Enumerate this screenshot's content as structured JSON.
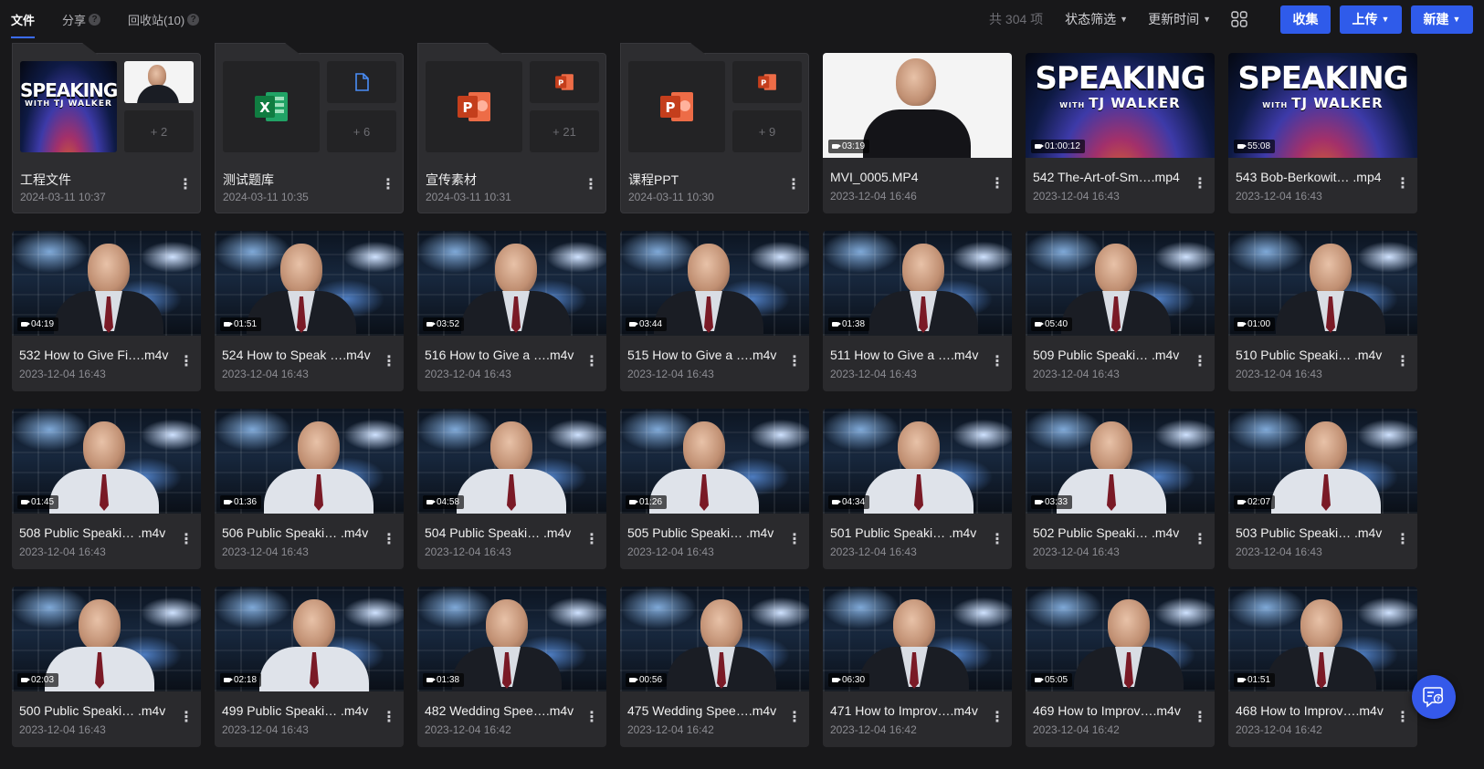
{
  "tabs": [
    {
      "label": "文件",
      "active": true
    },
    {
      "label": "分享",
      "help": "?"
    },
    {
      "label": "回收站(10)",
      "help": "?"
    }
  ],
  "toolbar": {
    "count": "共 304 项",
    "filter_label": "状态筛选",
    "sort_label": "更新时间",
    "collect_label": "收集",
    "upload_label": "上传",
    "new_label": "新建"
  },
  "folders": [
    {
      "name": "工程文件",
      "date": "2024-03-11 10:37",
      "more_count": "+ 2",
      "preview": "speaking"
    },
    {
      "name": "测试题库",
      "date": "2024-03-11 10:35",
      "more_count": "+ 6",
      "preview": "excel"
    },
    {
      "name": "宣传素材",
      "date": "2024-03-11 10:31",
      "more_count": "+ 21",
      "preview": "ppt"
    },
    {
      "name": "课程PPT",
      "date": "2024-03-11 10:30",
      "more_count": "+ 9",
      "preview": "ppt"
    }
  ],
  "videos": [
    {
      "name": "MVI_0005.MP4",
      "date": "2023-12-04 16:46",
      "duration": "03:19",
      "scene": "white"
    },
    {
      "name": "542 The-Art-of-Sm….mp4",
      "date": "2023-12-04 16:43",
      "duration": "01:00:12",
      "scene": "speaking"
    },
    {
      "name": "543 Bob-Berkowit… .mp4",
      "date": "2023-12-04 16:43",
      "duration": "55:08",
      "scene": "speaking"
    },
    {
      "name": "532 How to Give Fi….m4v",
      "date": "2023-12-04 16:43",
      "duration": "04:19",
      "scene": "studio"
    },
    {
      "name": "524 How to Speak ….m4v",
      "date": "2023-12-04 16:43",
      "duration": "01:51",
      "scene": "studio"
    },
    {
      "name": "516 How to Give a ….m4v",
      "date": "2023-12-04 16:43",
      "duration": "03:52",
      "scene": "studio"
    },
    {
      "name": "515 How to Give a ….m4v",
      "date": "2023-12-04 16:43",
      "duration": "03:44",
      "scene": "studio"
    },
    {
      "name": "511 How to Give a ….m4v",
      "date": "2023-12-04 16:43",
      "duration": "01:38",
      "scene": "studio"
    },
    {
      "name": "509 Public Speaki… .m4v",
      "date": "2023-12-04 16:43",
      "duration": "05:40",
      "scene": "studio"
    },
    {
      "name": "510 Public Speaki… .m4v",
      "date": "2023-12-04 16:43",
      "duration": "01:00",
      "scene": "studio"
    },
    {
      "name": "508 Public Speaki… .m4v",
      "date": "2023-12-04 16:43",
      "duration": "01:45",
      "scene": "studio-light"
    },
    {
      "name": "506 Public Speaki… .m4v",
      "date": "2023-12-04 16:43",
      "duration": "01:36",
      "scene": "studio-light"
    },
    {
      "name": "504 Public Speaki… .m4v",
      "date": "2023-12-04 16:43",
      "duration": "04:58",
      "scene": "studio-light"
    },
    {
      "name": "505 Public Speaki… .m4v",
      "date": "2023-12-04 16:43",
      "duration": "01:26",
      "scene": "studio-light"
    },
    {
      "name": "501 Public Speaki… .m4v",
      "date": "2023-12-04 16:43",
      "duration": "04:34",
      "scene": "studio-light"
    },
    {
      "name": "502 Public Speaki… .m4v",
      "date": "2023-12-04 16:43",
      "duration": "03:33",
      "scene": "studio-light"
    },
    {
      "name": "503 Public Speaki… .m4v",
      "date": "2023-12-04 16:43",
      "duration": "02:07",
      "scene": "studio-light"
    },
    {
      "name": "500 Public Speaki… .m4v",
      "date": "2023-12-04 16:43",
      "duration": "02:03",
      "scene": "studio-light"
    },
    {
      "name": "499 Public Speaki… .m4v",
      "date": "2023-12-04 16:43",
      "duration": "02:18",
      "scene": "studio-light"
    },
    {
      "name": "482 Wedding Spee….m4v",
      "date": "2023-12-04 16:42",
      "duration": "01:38",
      "scene": "studio"
    },
    {
      "name": "475 Wedding Spee….m4v",
      "date": "2023-12-04 16:42",
      "duration": "00:56",
      "scene": "studio"
    },
    {
      "name": "471 How to Improv….m4v",
      "date": "2023-12-04 16:42",
      "duration": "06:30",
      "scene": "studio"
    },
    {
      "name": "469 How to Improv….m4v",
      "date": "2023-12-04 16:42",
      "duration": "05:05",
      "scene": "studio"
    },
    {
      "name": "468 How to Improv….m4v",
      "date": "2023-12-04 16:42",
      "duration": "01:51",
      "scene": "studio"
    }
  ],
  "speaking_title": "SPEAKING",
  "speaking_with": "WITH",
  "speaking_name": "TJ WALKER",
  "more_glyph": "⋮",
  "icons": {
    "grid_view": "grid-view-icon",
    "help_fab": "feedback-help-icon",
    "excel": "excel-icon",
    "ppt": "powerpoint-icon",
    "doc": "document-icon"
  },
  "colors": {
    "accent": "#2f5bea",
    "background": "#18181a",
    "card": "#2a2a2d",
    "excel": "#1e9e4e",
    "ppt": "#e4512a"
  }
}
